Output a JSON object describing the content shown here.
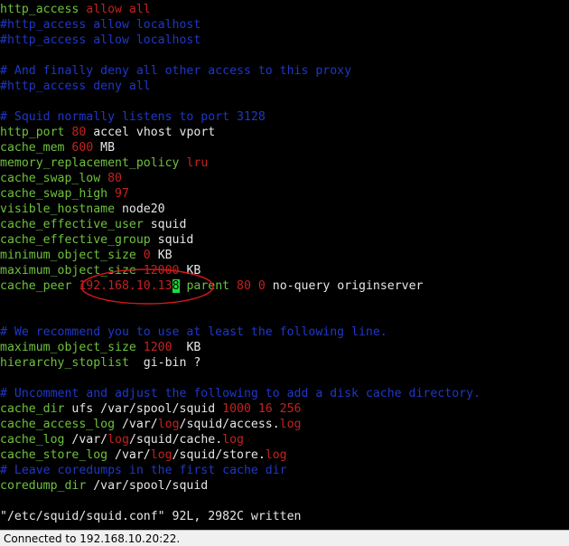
{
  "colors": {
    "directive": "#6ec13d",
    "value": "#c62020",
    "text": "#e6e6e6",
    "comment": "#1f37c8",
    "cursor": "#18e03a",
    "annotation": "#d01818"
  },
  "lines": [
    [
      [
        "k",
        "http_access "
      ],
      [
        "v",
        "allow all"
      ]
    ],
    [
      [
        "c",
        "#http_access allow localhost"
      ]
    ],
    [
      [
        "c",
        "#http_access allow localhost"
      ]
    ],
    [],
    [
      [
        "c",
        "# And finally deny all other access to this proxy"
      ]
    ],
    [
      [
        "c",
        "#http_access deny all"
      ]
    ],
    [],
    [
      [
        "c",
        "# Squid normally listens to port 3128"
      ]
    ],
    [
      [
        "k",
        "http_port "
      ],
      [
        "v",
        "80"
      ],
      [
        "t",
        " accel vhost vport"
      ]
    ],
    [
      [
        "k",
        "cache_mem "
      ],
      [
        "v",
        "600"
      ],
      [
        "t",
        " MB"
      ]
    ],
    [
      [
        "k",
        "memory_replacement_policy "
      ],
      [
        "v",
        "lru"
      ]
    ],
    [
      [
        "k",
        "cache_swap_low "
      ],
      [
        "v",
        "80"
      ]
    ],
    [
      [
        "k",
        "cache_swap_high "
      ],
      [
        "v",
        "97"
      ]
    ],
    [
      [
        "k",
        "visible_hostname "
      ],
      [
        "t",
        "node20"
      ]
    ],
    [
      [
        "k",
        "cache_effective_user "
      ],
      [
        "t",
        "squid"
      ]
    ],
    [
      [
        "k",
        "cache_effective_group "
      ],
      [
        "t",
        "squid"
      ]
    ],
    [
      [
        "k",
        "minimum_object_size "
      ],
      [
        "v",
        "0"
      ],
      [
        "t",
        " KB"
      ]
    ],
    [
      [
        "k",
        "maximum_object_size "
      ],
      [
        "v",
        "12000"
      ],
      [
        "t",
        " KB"
      ]
    ],
    [
      [
        "k",
        "cache_peer "
      ],
      [
        "v",
        "192.168.10.13"
      ],
      [
        "cur",
        "8"
      ],
      [
        "t",
        " "
      ],
      [
        "k",
        "parent "
      ],
      [
        "v",
        "80 0"
      ],
      [
        "t",
        " no-query originserver"
      ]
    ],
    [],
    [],
    [
      [
        "c",
        "# We recommend you to use at least the following line."
      ]
    ],
    [
      [
        "k",
        "maximum_object_size "
      ],
      [
        "v",
        "1200"
      ],
      [
        "t",
        "  KB"
      ]
    ],
    [
      [
        "k",
        "hierarchy_stoplist "
      ],
      [
        "t",
        " gi-bin ?"
      ]
    ],
    [],
    [
      [
        "c",
        "# Uncomment and adjust the following to add a disk cache directory."
      ]
    ],
    [
      [
        "k",
        "cache_dir "
      ],
      [
        "t",
        "ufs /var/spool/squid "
      ],
      [
        "v",
        "1000 16 256"
      ]
    ],
    [
      [
        "k",
        "cache_access_log "
      ],
      [
        "t",
        "/var/"
      ],
      [
        "v",
        "log"
      ],
      [
        "t",
        "/squid/access."
      ],
      [
        "v",
        "log"
      ]
    ],
    [
      [
        "k",
        "cache_log "
      ],
      [
        "t",
        "/var/"
      ],
      [
        "v",
        "log"
      ],
      [
        "t",
        "/squid/cache."
      ],
      [
        "v",
        "log"
      ]
    ],
    [
      [
        "k",
        "cache_store_log "
      ],
      [
        "t",
        "/var/"
      ],
      [
        "v",
        "log"
      ],
      [
        "t",
        "/squid/store."
      ],
      [
        "v",
        "log"
      ]
    ],
    [
      [
        "c",
        "# Leave coredumps in the first cache dir"
      ]
    ],
    [
      [
        "k",
        "coredump_dir "
      ],
      [
        "t",
        "/var/spool/squid"
      ]
    ],
    [],
    [
      [
        "t",
        "\"/etc/squid/squid.conf\" 92L, 2982C written"
      ]
    ]
  ],
  "status_bar": {
    "text": "Connected to 192.168.10.20:22."
  }
}
